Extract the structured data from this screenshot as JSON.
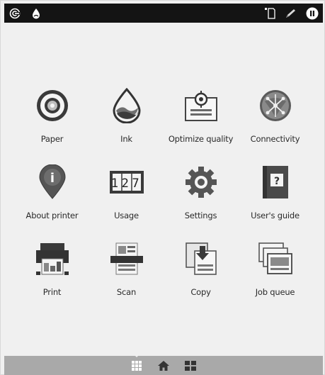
{
  "statusbar": {
    "left_icons": [
      "network-icon",
      "ink-drop-icon"
    ],
    "right_icons": [
      "paper-loaded-icon",
      "pen-icon",
      "pause-icon"
    ]
  },
  "apps": [
    {
      "label": "Paper",
      "icon": "paper-roll-icon"
    },
    {
      "label": "Ink",
      "icon": "ink-drop-icon"
    },
    {
      "label": "Optimize quality",
      "icon": "optimize-quality-icon"
    },
    {
      "label": "Connectivity",
      "icon": "connectivity-globe-icon"
    },
    {
      "label": "About printer",
      "icon": "info-pin-icon"
    },
    {
      "label": "Usage",
      "icon": "usage-counter-icon"
    },
    {
      "label": "Settings",
      "icon": "gear-icon"
    },
    {
      "label": "User's guide",
      "icon": "help-book-icon"
    },
    {
      "label": "Print",
      "icon": "printer-icon"
    },
    {
      "label": "Scan",
      "icon": "scanner-icon"
    },
    {
      "label": "Copy",
      "icon": "copy-icon"
    },
    {
      "label": "Job queue",
      "icon": "job-queue-icon"
    }
  ],
  "usage_digits": "127",
  "help_symbol": "?",
  "info_symbol": "i",
  "bottombar": {
    "icons": [
      "apps-grid-icon",
      "home-icon",
      "widgets-icon"
    ],
    "active": "apps-grid-icon"
  }
}
